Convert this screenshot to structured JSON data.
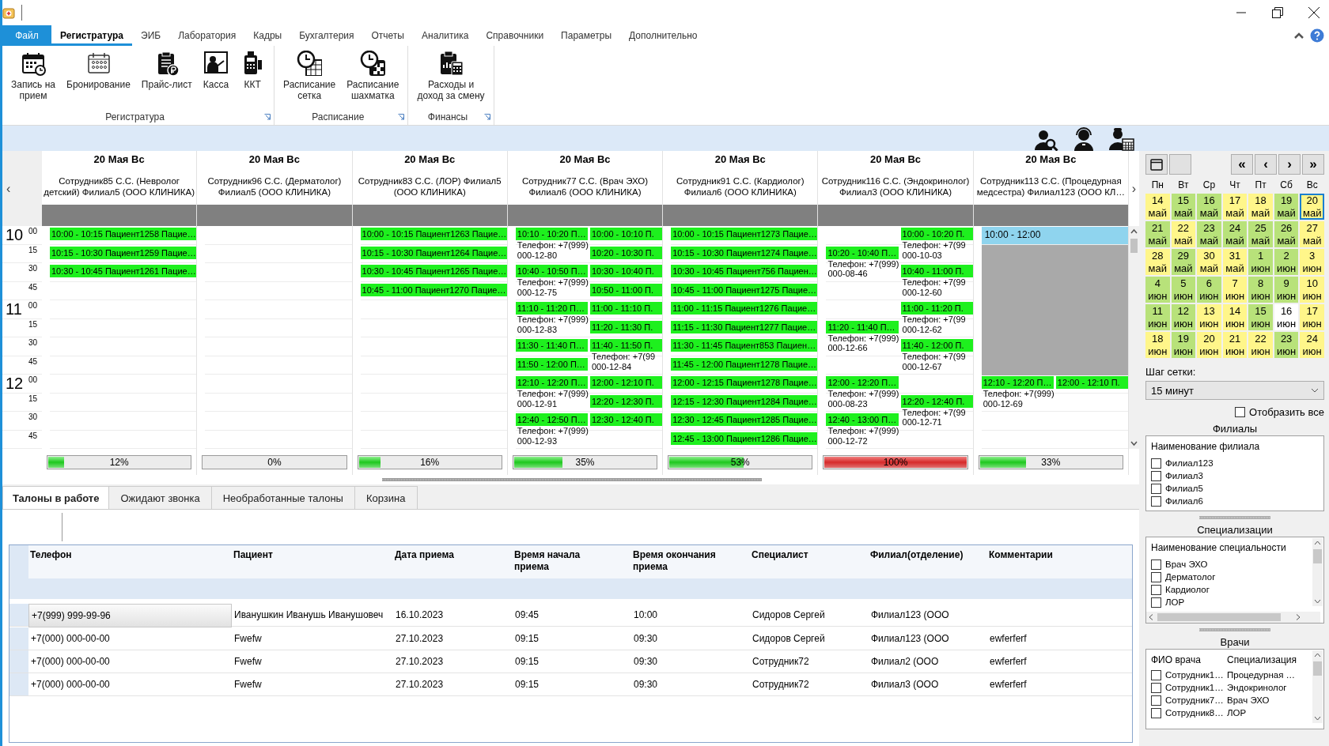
{
  "menu": {
    "tabs": [
      {
        "label": "Файл",
        "kind": "file",
        "selected": false
      },
      {
        "label": "Регистратура",
        "kind": "tab",
        "selected": true
      },
      {
        "label": "ЭИБ",
        "kind": "tab",
        "selected": false
      },
      {
        "label": "Лаборатория",
        "kind": "tab",
        "selected": false
      },
      {
        "label": "Кадры",
        "kind": "tab",
        "selected": false
      },
      {
        "label": "Бухгалтерия",
        "kind": "tab",
        "selected": false
      },
      {
        "label": "Отчеты",
        "kind": "tab",
        "selected": false
      },
      {
        "label": "Аналитика",
        "kind": "tab",
        "selected": false
      },
      {
        "label": "Справочники",
        "kind": "tab",
        "selected": false
      },
      {
        "label": "Параметры",
        "kind": "tab",
        "selected": false
      },
      {
        "label": "Дополнительно",
        "kind": "tab",
        "selected": false
      }
    ]
  },
  "ribbon": {
    "groups": [
      {
        "title": "Регистратура",
        "buttons": [
          {
            "label": "Запись на\nприем"
          },
          {
            "label": "Бронирование"
          },
          {
            "label": "Прайс-лист"
          },
          {
            "label": "Касса"
          },
          {
            "label": "ККТ"
          }
        ]
      },
      {
        "title": "Расписание",
        "buttons": [
          {
            "label": "Расписание\nсетка"
          },
          {
            "label": "Расписание\nшахматка"
          }
        ]
      },
      {
        "title": "Финансы",
        "buttons": [
          {
            "label": "Расходы и\nдоход за смену"
          }
        ]
      }
    ]
  },
  "schedule": {
    "nav_prev": "‹",
    "nav_next": "›",
    "times": [
      {
        "hour": "10",
        "minute": "00"
      },
      {
        "minute": "15"
      },
      {
        "minute": "30"
      },
      {
        "minute": "45"
      },
      {
        "hour": "11",
        "minute": "00"
      },
      {
        "minute": "15"
      },
      {
        "minute": "30"
      },
      {
        "minute": "45"
      },
      {
        "hour": "12",
        "minute": "00"
      },
      {
        "minute": "15"
      },
      {
        "minute": "30"
      },
      {
        "minute": "45"
      }
    ],
    "columns": [
      {
        "date": "20 Мая Вс",
        "doctor": "Сотрудник85 С.С. (Невролог детский) Филиал5 (ООО КЛИНИКА)",
        "load": {
          "level": 0.12,
          "reading": "12%"
        },
        "rows": [
          {
            "cells": [
              {
                "kind": "appt",
                "title": "10:00 - 10:15 Пациент1258 Пацие…"
              }
            ]
          },
          {
            "cells": [
              {
                "kind": "appt",
                "title": "10:15 - 10:30 Пациент1259 Пацие…"
              }
            ]
          },
          {
            "cells": [
              {
                "kind": "appt",
                "title": "10:30 - 10:45 Пациент1261 Пацие…"
              }
            ]
          },
          {
            "cells": [
              {
                "kind": "empty"
              }
            ]
          },
          {
            "cells": [
              {
                "kind": "empty"
              }
            ]
          },
          {
            "cells": [
              {
                "kind": "empty"
              }
            ]
          },
          {
            "cells": [
              {
                "kind": "empty"
              }
            ]
          },
          {
            "cells": [
              {
                "kind": "empty"
              }
            ]
          },
          {
            "cells": [
              {
                "kind": "empty"
              }
            ]
          },
          {
            "cells": [
              {
                "kind": "empty"
              }
            ]
          },
          {
            "cells": [
              {
                "kind": "empty"
              }
            ]
          },
          {
            "cells": [
              {
                "kind": "empty"
              }
            ]
          }
        ]
      },
      {
        "date": "20 Мая Вс",
        "doctor": "Сотрудник96 С.С. (Дерматолог) Филиал5 (ООО КЛИНИКА)",
        "load": {
          "level": 0,
          "reading": "0%"
        },
        "rows": [
          {
            "cells": [
              {
                "kind": "empty"
              }
            ]
          },
          {
            "cells": [
              {
                "kind": "empty"
              }
            ]
          },
          {
            "cells": [
              {
                "kind": "empty"
              }
            ]
          },
          {
            "cells": [
              {
                "kind": "empty"
              }
            ]
          },
          {
            "cells": [
              {
                "kind": "empty"
              }
            ]
          },
          {
            "cells": [
              {
                "kind": "empty"
              }
            ]
          },
          {
            "cells": [
              {
                "kind": "empty"
              }
            ]
          },
          {
            "cells": [
              {
                "kind": "empty"
              }
            ]
          },
          {
            "cells": [
              {
                "kind": "empty"
              }
            ]
          },
          {
            "cells": [
              {
                "kind": "empty"
              }
            ]
          },
          {
            "cells": [
              {
                "kind": "empty"
              }
            ]
          },
          {
            "cells": [
              {
                "kind": "empty"
              }
            ]
          }
        ]
      },
      {
        "date": "20 Мая Вс",
        "doctor": "Сотрудник83 С.С. (ЛОР) Филиал5 (ООО КЛИНИКА)",
        "load": {
          "level": 0.16,
          "reading": "16%"
        },
        "rows": [
          {
            "cells": [
              {
                "kind": "appt",
                "title": "10:00 - 10:15 Пациент1263 Пацие…"
              }
            ]
          },
          {
            "cells": [
              {
                "kind": "appt",
                "title": "10:15 - 10:30 Пациент1264 Пацие…"
              }
            ]
          },
          {
            "cells": [
              {
                "kind": "appt",
                "title": "10:30 - 10:45 Пациент1265 Пацие…"
              }
            ]
          },
          {
            "cells": [
              {
                "kind": "appt",
                "title": "10:45 - 11:00 Пациент1270 Пацие…"
              }
            ]
          },
          {
            "cells": [
              {
                "kind": "empty"
              }
            ]
          },
          {
            "cells": [
              {
                "kind": "empty"
              }
            ]
          },
          {
            "cells": [
              {
                "kind": "empty"
              }
            ]
          },
          {
            "cells": [
              {
                "kind": "empty"
              }
            ]
          },
          {
            "cells": [
              {
                "kind": "empty"
              }
            ]
          },
          {
            "cells": [
              {
                "kind": "empty"
              }
            ]
          },
          {
            "cells": [
              {
                "kind": "empty"
              }
            ]
          },
          {
            "cells": [
              {
                "kind": "empty"
              }
            ]
          }
        ]
      },
      {
        "date": "20 Мая Вс",
        "doctor": "Сотрудник77 С.С. (Врач ЭХО) Филиал6 (ООО КЛИНИКА)",
        "load": {
          "level": 0.35,
          "reading": "35%"
        },
        "rows": [
          {
            "cells": [
              {
                "kind": "appt",
                "title": "10:10 - 10:20 П…",
                "phone": [
                  "Телефон: +7(999)",
                  "000-12-80"
                ]
              },
              {
                "kind": "appt",
                "title": "10:00 - 10:10 П."
              }
            ]
          },
          {
            "cells": [
              {
                "kind": "empty"
              },
              {
                "kind": "appt",
                "title": "10:20 - 10:30 П."
              }
            ]
          },
          {
            "cells": [
              {
                "kind": "appt",
                "title": "10:40 - 10:50 П…",
                "phone": [
                  "Телефон: +7(999)",
                  "000-12-75"
                ]
              },
              {
                "kind": "appt",
                "title": "10:30 - 10:40 П."
              }
            ]
          },
          {
            "cells": [
              {
                "kind": "empty"
              },
              {
                "kind": "appt",
                "title": "10:50 - 11:00 П."
              }
            ]
          },
          {
            "cells": [
              {
                "kind": "appt",
                "title": "11:10 - 11:20 П…",
                "phone": [
                  "Телефон: +7(999)",
                  "000-12-83"
                ]
              },
              {
                "kind": "appt",
                "title": "11:00 - 11:10 П."
              }
            ]
          },
          {
            "cells": [
              {
                "kind": "empty"
              },
              {
                "kind": "appt",
                "title": "11:20 - 11:30 П."
              }
            ]
          },
          {
            "cells": [
              {
                "kind": "appt",
                "title": "11:30 - 11:40 П…"
              },
              {
                "kind": "appt",
                "title": "11:40 - 11:50 П.",
                "phone": [
                  "Телефон: +7(99",
                  "000-12-84"
                ]
              }
            ]
          },
          {
            "cells": [
              {
                "kind": "appt",
                "title": "11:50 - 12:00 П…"
              },
              {
                "kind": "empty"
              }
            ]
          },
          {
            "cells": [
              {
                "kind": "appt",
                "title": "12:10 - 12:20 П…",
                "phone": [
                  "Телефон: +7(999)",
                  "000-12-91"
                ]
              },
              {
                "kind": "appt",
                "title": "12:00 - 12:10 П."
              }
            ]
          },
          {
            "cells": [
              {
                "kind": "empty"
              },
              {
                "kind": "appt",
                "title": "12:20 - 12:30 П."
              }
            ]
          },
          {
            "cells": [
              {
                "kind": "appt",
                "title": "12:40 - 12:50 П…",
                "phone": [
                  "Телефон: +7(999)",
                  "000-12-93"
                ]
              },
              {
                "kind": "appt",
                "title": "12:30 - 12:40 П."
              }
            ]
          },
          {
            "cells": [
              {
                "kind": "empty"
              },
              {
                "kind": "empty"
              }
            ]
          }
        ]
      },
      {
        "date": "20 Мая Вс",
        "doctor": "Сотрудник91 С.С. (Кардиолог) Филиал6 (ООО КЛИНИКА)",
        "load": {
          "level": 0.53,
          "reading": "53%"
        },
        "rows": [
          {
            "cells": [
              {
                "kind": "appt",
                "title": "10:00 - 10:15 Пациент1273 Пацие…"
              }
            ]
          },
          {
            "cells": [
              {
                "kind": "appt",
                "title": "10:15 - 10:30 Пациент1274 Пацие…"
              }
            ]
          },
          {
            "cells": [
              {
                "kind": "appt",
                "title": "10:30 - 10:45 Пациент756 Пациен…"
              }
            ]
          },
          {
            "cells": [
              {
                "kind": "appt",
                "title": "10:45 - 11:00 Пациент1275 Пацие…"
              }
            ]
          },
          {
            "cells": [
              {
                "kind": "appt",
                "title": "11:00 - 11:15 Пациент1276 Пацие…"
              }
            ]
          },
          {
            "cells": [
              {
                "kind": "appt",
                "title": "11:15 - 11:30 Пациент1277 Пацие…"
              }
            ]
          },
          {
            "cells": [
              {
                "kind": "appt",
                "title": "11:30 - 11:45 Пациент853 Пациен…"
              }
            ]
          },
          {
            "cells": [
              {
                "kind": "appt",
                "title": "11:45 - 12:00 Пациент1278 Пацие…"
              }
            ]
          },
          {
            "cells": [
              {
                "kind": "appt",
                "title": "12:00 - 12:15 Пациент1278 Пацие…"
              }
            ]
          },
          {
            "cells": [
              {
                "kind": "appt",
                "title": "12:15 - 12:30 Пациент1284 Пацие…"
              }
            ]
          },
          {
            "cells": [
              {
                "kind": "appt",
                "title": "12:30 - 12:45 Пациент1285 Пацие…"
              }
            ]
          },
          {
            "cells": [
              {
                "kind": "appt",
                "title": "12:45 - 13:00 Пациент1286 Пацие…"
              }
            ]
          }
        ]
      },
      {
        "date": "20 Мая Вс",
        "doctor": "Сотрудник116 С.С. (Эндокринолог) Филиал3 (ООО КЛИНИКА)",
        "load": {
          "level": 1,
          "reading": "100%"
        },
        "rows": [
          {
            "cells": [
              {
                "kind": "empty"
              },
              {
                "kind": "appt",
                "title": "10:00 - 10:20 П.",
                "phone": [
                  "Телефон: +7(99",
                  "000-10-03"
                ]
              }
            ]
          },
          {
            "cells": [
              {
                "kind": "appt",
                "title": "10:20 - 10:40 П…",
                "phone": [
                  "Телефон: +7(999)",
                  "000-08-46"
                ]
              },
              {
                "kind": "empty"
              }
            ]
          },
          {
            "cells": [
              {
                "kind": "empty"
              },
              {
                "kind": "appt",
                "title": "10:40 - 11:00 П.",
                "phone": [
                  "Телефон: +7(99",
                  "000-12-60"
                ]
              }
            ]
          },
          {
            "cells": [
              {
                "kind": "empty"
              },
              {
                "kind": "empty"
              }
            ]
          },
          {
            "cells": [
              {
                "kind": "empty"
              },
              {
                "kind": "appt",
                "title": "11:00 - 11:20 П.",
                "phone": [
                  "Телефон: +7(99",
                  "000-12-62"
                ]
              }
            ]
          },
          {
            "cells": [
              {
                "kind": "appt",
                "title": "11:20 - 11:40 П…",
                "phone": [
                  "Телефон: +7(999)",
                  "000-12-66"
                ]
              },
              {
                "kind": "empty"
              }
            ]
          },
          {
            "cells": [
              {
                "kind": "empty"
              },
              {
                "kind": "appt",
                "title": "11:40 - 12:00 П.",
                "phone": [
                  "Телефон: +7(99",
                  "000-12-67"
                ]
              }
            ]
          },
          {
            "cells": [
              {
                "kind": "empty"
              },
              {
                "kind": "empty"
              }
            ]
          },
          {
            "cells": [
              {
                "kind": "appt",
                "title": "12:00 - 12:20 П…",
                "phone": [
                  "Телефон: +7(999)",
                  "000-08-23"
                ]
              },
              {
                "kind": "empty"
              }
            ]
          },
          {
            "cells": [
              {
                "kind": "empty"
              },
              {
                "kind": "appt",
                "title": "12:20 - 12:40 П.",
                "phone": [
                  "Телефон: +7(99",
                  "000-12-71"
                ]
              }
            ]
          },
          {
            "cells": [
              {
                "kind": "appt",
                "title": "12:40 - 13:00 П…",
                "phone": [
                  "Телефон: +7(999)",
                  "000-12-72"
                ]
              },
              {
                "kind": "empty"
              }
            ]
          },
          {
            "cells": [
              {
                "kind": "empty"
              },
              {
                "kind": "empty"
              }
            ]
          }
        ]
      },
      {
        "date": "20 Мая Вс",
        "doctor": "Сотрудник113 С.С. (Процедурная медсестра) Филиал123 (ООО КЛ…",
        "load": {
          "level": 0.33,
          "reading": "33%"
        },
        "rows": [
          {
            "cells": [
              {
                "kind": "free",
                "title": "10:00 - 12:00"
              }
            ]
          },
          {
            "cells": [
              {
                "kind": "busy"
              }
            ]
          },
          {
            "cells": [
              {
                "kind": "busy"
              }
            ]
          },
          {
            "cells": [
              {
                "kind": "busy"
              }
            ]
          },
          {
            "cells": [
              {
                "kind": "busy"
              }
            ]
          },
          {
            "cells": [
              {
                "kind": "busy"
              }
            ]
          },
          {
            "cells": [
              {
                "kind": "busy"
              }
            ]
          },
          {
            "cells": [
              {
                "kind": "busy"
              }
            ]
          },
          {
            "cells": [
              {
                "kind": "appt",
                "title": "12:10 - 12:20 П…",
                "phone": [
                  "Телефон: +7(999)",
                  "000-12-69"
                ]
              },
              {
                "kind": "appt",
                "title": "12:00 - 12:10 П."
              }
            ]
          },
          {
            "cells": [
              {
                "kind": "empty"
              }
            ]
          },
          {
            "cells": [
              {
                "kind": "empty"
              }
            ]
          },
          {
            "cells": [
              {
                "kind": "empty"
              }
            ]
          }
        ]
      }
    ]
  },
  "calendar": {
    "nav": [
      "«",
      "‹",
      "›",
      "»"
    ],
    "weekdays": [
      "Пн",
      "Вт",
      "Ср",
      "Чт",
      "Пт",
      "Сб",
      "Вс"
    ],
    "days": [
      {
        "day": "14",
        "month": "май",
        "color": "#fff68a",
        "selected": false
      },
      {
        "day": "15",
        "month": "май",
        "color": "#b8e27a",
        "selected": false
      },
      {
        "day": "16",
        "month": "май",
        "color": "#b8e27a",
        "selected": false
      },
      {
        "day": "17",
        "month": "май",
        "color": "#fff68a",
        "selected": false
      },
      {
        "day": "18",
        "month": "май",
        "color": "#fff68a",
        "selected": false
      },
      {
        "day": "19",
        "month": "май",
        "color": "#b8e27a",
        "selected": false
      },
      {
        "day": "20",
        "month": "май",
        "color": "#fff68a",
        "selected": true
      },
      {
        "day": "21",
        "month": "май",
        "color": "#b8e27a",
        "selected": false
      },
      {
        "day": "22",
        "month": "май",
        "color": "#fff68a",
        "selected": false
      },
      {
        "day": "23",
        "month": "май",
        "color": "#b8e27a",
        "selected": false
      },
      {
        "day": "24",
        "month": "май",
        "color": "#b8e27a",
        "selected": false
      },
      {
        "day": "25",
        "month": "май",
        "color": "#b8e27a",
        "selected": false
      },
      {
        "day": "26",
        "month": "май",
        "color": "#b8e27a",
        "selected": false
      },
      {
        "day": "27",
        "month": "май",
        "color": "#fff68a",
        "selected": false
      },
      {
        "day": "28",
        "month": "май",
        "color": "#fff68a",
        "selected": false
      },
      {
        "day": "29",
        "month": "май",
        "color": "#b8e27a",
        "selected": false
      },
      {
        "day": "30",
        "month": "май",
        "color": "#fff68a",
        "selected": false
      },
      {
        "day": "31",
        "month": "май",
        "color": "#fff68a",
        "selected": false
      },
      {
        "day": "1",
        "month": "июн",
        "color": "#b8e27a",
        "selected": false
      },
      {
        "day": "2",
        "month": "июн",
        "color": "#b8e27a",
        "selected": false
      },
      {
        "day": "3",
        "month": "июн",
        "color": "#fff68a",
        "selected": false
      },
      {
        "day": "4",
        "month": "июн",
        "color": "#b8e27a",
        "selected": false
      },
      {
        "day": "5",
        "month": "июн",
        "color": "#b8e27a",
        "selected": false
      },
      {
        "day": "6",
        "month": "июн",
        "color": "#b8e27a",
        "selected": false
      },
      {
        "day": "7",
        "month": "июн",
        "color": "#fff68a",
        "selected": false
      },
      {
        "day": "8",
        "month": "июн",
        "color": "#b8e27a",
        "selected": false
      },
      {
        "day": "9",
        "month": "июн",
        "color": "#b8e27a",
        "selected": false
      },
      {
        "day": "10",
        "month": "июн",
        "color": "#fff68a",
        "selected": false
      },
      {
        "day": "11",
        "month": "июн",
        "color": "#b8e27a",
        "selected": false
      },
      {
        "day": "12",
        "month": "июн",
        "color": "#b8e27a",
        "selected": false
      },
      {
        "day": "13",
        "month": "июн",
        "color": "#fff68a",
        "selected": false
      },
      {
        "day": "14",
        "month": "июн",
        "color": "#fff68a",
        "selected": false
      },
      {
        "day": "15",
        "month": "июн",
        "color": "#b8e27a",
        "selected": false
      },
      {
        "day": "16",
        "month": "июн",
        "color": "#ffffff",
        "selected": false
      },
      {
        "day": "17",
        "month": "июн",
        "color": "#fff68a",
        "selected": false
      },
      {
        "day": "18",
        "month": "июн",
        "color": "#fff68a",
        "selected": false
      },
      {
        "day": "19",
        "month": "июн",
        "color": "#b8e27a",
        "selected": false
      },
      {
        "day": "20",
        "month": "июн",
        "color": "#fff68a",
        "selected": false
      },
      {
        "day": "21",
        "month": "июн",
        "color": "#fff68a",
        "selected": false
      },
      {
        "day": "22",
        "month": "июн",
        "color": "#fff68a",
        "selected": false
      },
      {
        "day": "23",
        "month": "июн",
        "color": "#b8e27a",
        "selected": false
      },
      {
        "day": "24",
        "month": "июн",
        "color": "#fff68a",
        "selected": false
      }
    ]
  },
  "grid_step": {
    "label": "Шаг сетки:",
    "value": "15 минут"
  },
  "show_all": {
    "label": "Отобразить все",
    "checked": false
  },
  "branches": {
    "title": "Филиалы",
    "header": "Наименование филиала",
    "items": [
      {
        "label": "Филиал123",
        "checked": false
      },
      {
        "label": "Филиал3",
        "checked": false
      },
      {
        "label": "Филиал5",
        "checked": false
      },
      {
        "label": "Филиал6",
        "checked": false
      }
    ]
  },
  "specialties": {
    "title": "Специализации",
    "header": "Наименование специальности",
    "items": [
      {
        "label": "Врач ЭХО",
        "checked": false
      },
      {
        "label": "Дерматолог",
        "checked": false
      },
      {
        "label": "Кардиолог",
        "checked": false
      },
      {
        "label": "ЛОР",
        "checked": false
      }
    ]
  },
  "doctors": {
    "title": "Врачи",
    "columns": [
      "ФИО врача",
      "Специализация"
    ],
    "rows": [
      {
        "name": "Сотрудник1…",
        "specialty": "Процедурная …",
        "checked": false
      },
      {
        "name": "Сотрудник1…",
        "specialty": "Эндокринолог",
        "checked": false
      },
      {
        "name": "Сотрудник7…",
        "specialty": "Врач ЭХО",
        "checked": false
      },
      {
        "name": "Сотрудник8…",
        "specialty": "ЛОР",
        "checked": false
      }
    ]
  },
  "tickets": {
    "tabs": [
      {
        "label": "Талоны в работе",
        "selected": true
      },
      {
        "label": "Ожидают звонка",
        "selected": false
      },
      {
        "label": "Необработанные талоны",
        "selected": false
      },
      {
        "label": "Корзина",
        "selected": false
      }
    ],
    "table": {
      "columns": [
        "Телефон",
        "Пациент",
        "Дата приема",
        "Время начала приема",
        "Время окончания приема",
        "Специалист",
        "Филиал(отделение)",
        "Комментарии"
      ],
      "rows": [
        {
          "selected": true,
          "cells": [
            "+7(999) 999-99-96",
            "Иванушкин Иванушь Иванушовеч",
            "16.10.2023",
            "09:45",
            "10:00",
            "Сидоров Сергей",
            "Филиал123 (ООО"
          ]
        },
        {
          "selected": false,
          "cells": [
            "+7(000) 000-00-00",
            "Fwefw",
            "27.10.2023",
            "09:15",
            "09:30",
            "Сидоров Сергей",
            "Филиал123 (ООО",
            "ewferferf"
          ]
        },
        {
          "selected": false,
          "cells": [
            "+7(000) 000-00-00",
            "Fwefw",
            "27.10.2023",
            "09:15",
            "09:30",
            "Сотрудник72",
            "Филиал2 (ООО",
            "ewferferf"
          ]
        },
        {
          "selected": false,
          "cells": [
            "+7(000) 000-00-00",
            "Fwefw",
            "27.10.2023",
            "09:15",
            "09:30",
            "Сотрудник72",
            "Филиал3 (ООО",
            "ewferferf"
          ]
        }
      ]
    }
  }
}
